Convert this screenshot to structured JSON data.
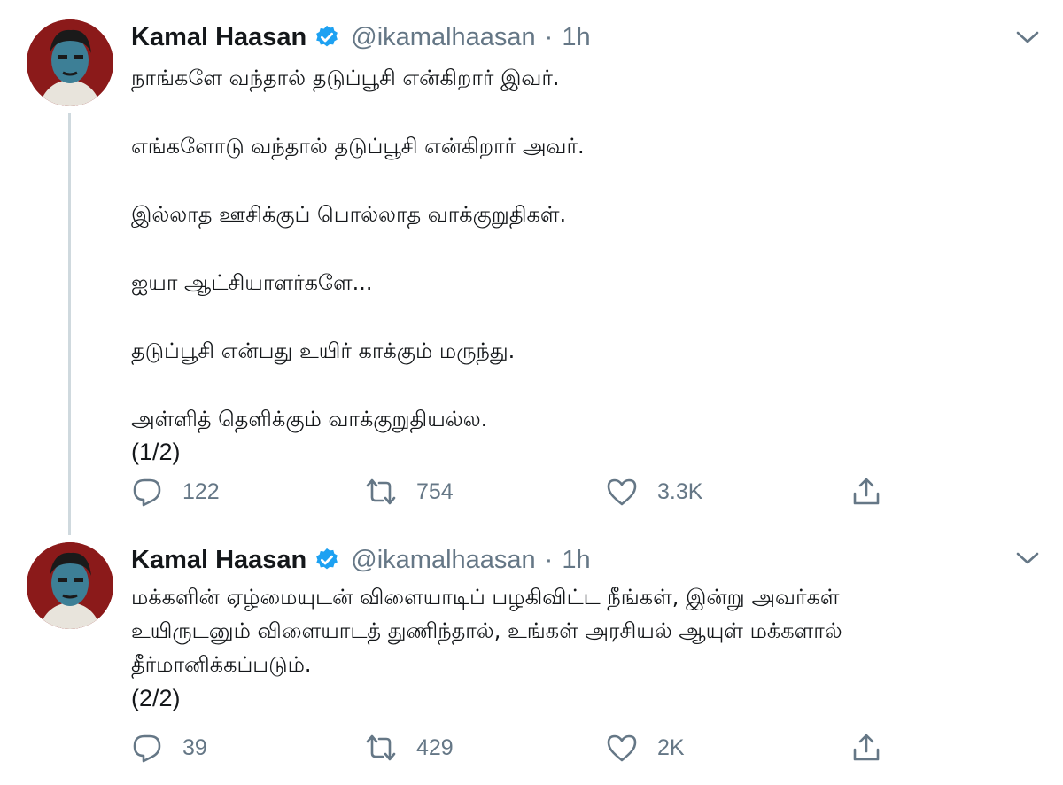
{
  "colors": {
    "text": "#14171a",
    "muted": "#657786",
    "verified": "#1da1f2",
    "avatar_bg": "#8b1a1a"
  },
  "icons": [
    "verified-badge-icon",
    "chevron-down-icon",
    "reply-icon",
    "retweet-icon",
    "like-icon",
    "share-icon"
  ],
  "tweets": [
    {
      "author": {
        "name": "Kamal Haasan",
        "handle": "@ikamalhaasan",
        "time": "1h"
      },
      "dot": "·",
      "lines": [
        "நாங்களே வந்தால் தடுப்பூசி என்கிறார் இவர்.",
        "எங்களோடு வந்தால் தடுப்பூசி என்கிறார் அவர்.",
        "இல்லாத ஊசிக்குப் பொல்லாத வாக்குறுதிகள்.",
        "ஐயா ஆட்சியாளர்களே...",
        "தடுப்பூசி என்பது உயிர் காக்கும்  மருந்து.",
        "அள்ளித் தெளிக்கும் வாக்குறுதியல்ல.",
        "(1/2)"
      ],
      "stats": {
        "replies": "122",
        "retweets": "754",
        "likes": "3.3K"
      }
    },
    {
      "author": {
        "name": "Kamal Haasan",
        "handle": "@ikamalhaasan",
        "time": "1h"
      },
      "dot": "·",
      "lines": [
        "மக்களின் ஏழ்மையுடன் விளையாடிப் பழகிவிட்ட நீங்கள், இன்று அவர்கள்",
        "உயிருடனும் விளையாடத் துணிந்தால், உங்கள் அரசியல் ஆயுள் மக்களால்",
        "தீர்மானிக்கப்படும்.",
        "(2/2)"
      ],
      "stats": {
        "replies": "39",
        "retweets": "429",
        "likes": "2K"
      }
    }
  ]
}
